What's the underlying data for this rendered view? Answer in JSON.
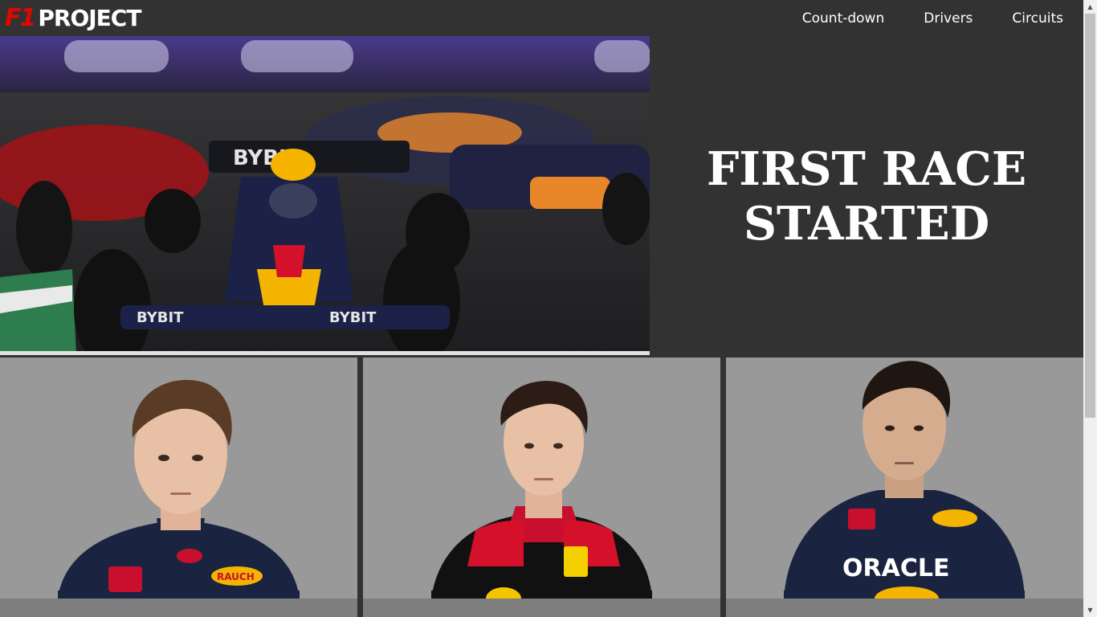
{
  "brand": {
    "mark": "F1",
    "name": "PROJECT"
  },
  "nav": {
    "links": [
      "Count-down",
      "Drivers",
      "Circuits"
    ]
  },
  "hero": {
    "title": "FIRST RACE STARTED"
  },
  "drivers": {
    "cards": [
      {
        "team_colors": {
          "suit": "#1a2441",
          "accent": "#e10600"
        }
      },
      {
        "team_colors": {
          "suit": "#111111",
          "accent": "#d4102a"
        }
      },
      {
        "team_colors": {
          "suit": "#1a2441",
          "accent": "#ffcc00"
        }
      }
    ]
  },
  "colors": {
    "background": "#323232",
    "card": "#999999",
    "f1_red": "#e10600",
    "text": "#ffffff"
  }
}
